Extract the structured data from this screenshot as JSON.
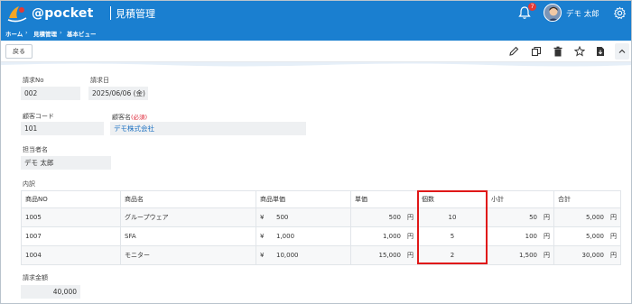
{
  "header": {
    "logo_text": "@pocket",
    "app_title": "見積管理",
    "notification_count": "7",
    "user_name": "デモ 太郎"
  },
  "breadcrumb": [
    "ホーム",
    "見積管理",
    "基本ビュー"
  ],
  "breadcrumb_separator": "›",
  "toolbar": {
    "back_label": "戻る",
    "icons": [
      "pencil-icon",
      "copy-icon",
      "trash-icon",
      "star-icon",
      "download-icon",
      "chevron-up-icon"
    ]
  },
  "form": {
    "invoice_no_label": "請求No",
    "invoice_no": "002",
    "invoice_date_label": "請求日",
    "invoice_date": "2025/06/06 (金)",
    "customer_code_label": "顧客コード",
    "customer_code": "101",
    "customer_name_label": "顧客名",
    "required_mark": "(必須)",
    "customer_name": "デモ株式会社",
    "staff_label": "担当者名",
    "staff": "デモ 太郎",
    "details_label": "内訳",
    "total_label": "請求金額",
    "total": "40,000"
  },
  "table": {
    "headers": [
      "商品NO",
      "商品名",
      "商品単価",
      "単価",
      "個数",
      "小計",
      "合計"
    ],
    "currency": "¥",
    "unit": "円",
    "rows": [
      {
        "no": "1005",
        "name": "グループウェア",
        "list_price": "500",
        "price": "500",
        "qty": "10",
        "subtotal": "50",
        "total": "5,000"
      },
      {
        "no": "1007",
        "name": "SFA",
        "list_price": "1,000",
        "price": "1,000",
        "qty": "5",
        "subtotal": "100",
        "total": "5,000"
      },
      {
        "no": "1004",
        "name": "モニター",
        "list_price": "10,000",
        "price": "15,000",
        "qty": "2",
        "subtotal": "1,500",
        "total": "30,000"
      }
    ]
  },
  "colors": {
    "header_bg": "#1a7fd0",
    "highlight": "#e01818",
    "link": "#1a6fc1"
  }
}
